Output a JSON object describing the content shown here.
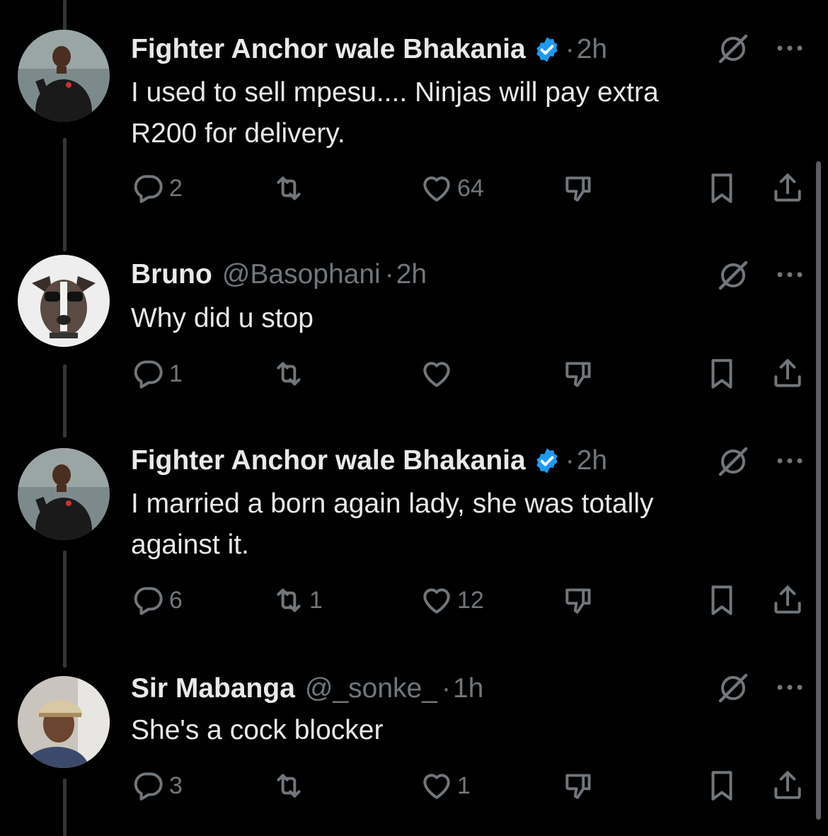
{
  "tweets": [
    {
      "name": "Fighter Anchor wale Bhakania",
      "handle": "",
      "dot": "·",
      "time": "2h",
      "verified": true,
      "text": "I used to sell mpesu.... Ninjas will pay extra\nR200 for delivery.",
      "replies": "2",
      "retweets": "",
      "likes": "64",
      "avatar": "soccer-player-avatar"
    },
    {
      "name": "Bruno",
      "handle": "@Basophani",
      "dot": "·",
      "time": "2h",
      "verified": false,
      "text": "Why did u stop",
      "replies": "1",
      "retweets": "",
      "likes": "",
      "avatar": "dog-sunglasses-avatar"
    },
    {
      "name": "Fighter Anchor wale Bhakania",
      "handle": "",
      "dot": "·",
      "time": "2h",
      "verified": true,
      "text": "I married a born again lady, she was totally\nagainst it.",
      "replies": "6",
      "retweets": "1",
      "likes": "12",
      "avatar": "soccer-player-avatar"
    },
    {
      "name": "Sir Mabanga",
      "handle": "@_sonke_",
      "dot": "·",
      "time": "1h",
      "verified": false,
      "text": "She's a cock blocker",
      "replies": "3",
      "retweets": "",
      "likes": "1",
      "avatar": "man-cap-avatar"
    }
  ],
  "colors": {
    "background": "#000000",
    "text": "#e7e9ea",
    "muted": "#71767b",
    "verified": "#1d9bf0",
    "thread_line": "#333639"
  },
  "icons": [
    "reply-icon",
    "retweet-icon",
    "like-icon",
    "dislike-icon",
    "bookmark-icon",
    "share-icon",
    "grok-icon",
    "more-icon",
    "verified-badge-icon"
  ]
}
